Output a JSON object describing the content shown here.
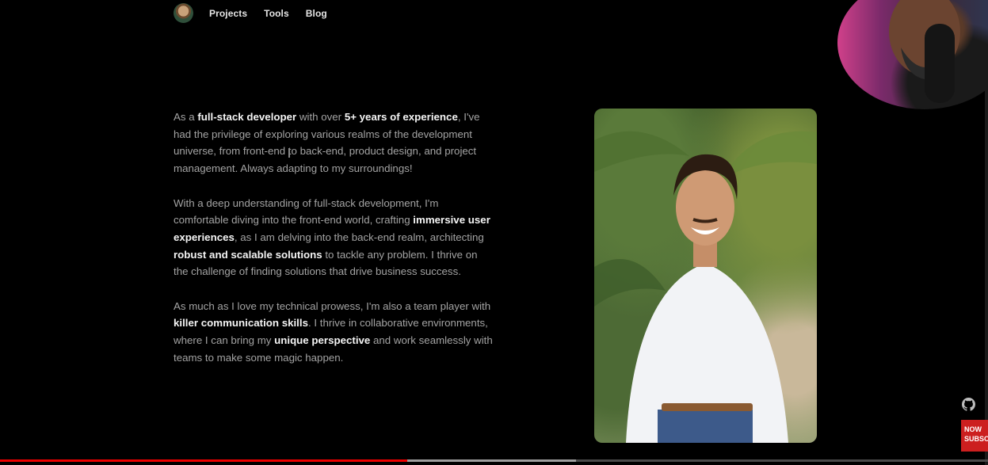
{
  "nav": {
    "links": [
      "Projects",
      "Tools",
      "Blog"
    ]
  },
  "about": {
    "p1": [
      {
        "t": "As a ",
        "b": false
      },
      {
        "t": "full-stack developer",
        "b": true
      },
      {
        "t": " with over ",
        "b": false
      },
      {
        "t": "5+ years of experience",
        "b": true
      },
      {
        "t": ", I've had the privilege of exploring various realms of the development universe, from front-end to back-end, product design, and project management. Always adapting to my surroundings!",
        "b": false
      }
    ],
    "p2": [
      {
        "t": "With a deep understanding of full-stack development, I'm comfortable diving into the front-end world, crafting ",
        "b": false
      },
      {
        "t": "immersive user experiences",
        "b": true
      },
      {
        "t": ", as I am delving into the back-end realm, architecting ",
        "b": false
      },
      {
        "t": "robust and scalable solutions",
        "b": true
      },
      {
        "t": " to tackle any problem. I thrive on the challenge of finding solutions that drive business success.",
        "b": false
      }
    ],
    "p3": [
      {
        "t": "As much as I love my technical prowess, I'm also a team player with ",
        "b": false
      },
      {
        "t": "killer communication skills",
        "b": true
      },
      {
        "t": ". I thrive in collaborative environments, where I can bring my ",
        "b": false
      },
      {
        "t": "unique perspective",
        "b": true
      },
      {
        "t": " and work seamlessly with teams to make some magic happen.",
        "b": false
      }
    ]
  },
  "video": {
    "played_fraction": 0.412,
    "buffered_fraction": 0.583,
    "subscribe_text": "NOW SUBSCRIBE"
  },
  "colors": {
    "background": "#000000",
    "body_text": "#a3a3a3",
    "emphasis_text": "#f5f5f5",
    "progress_played": "#ee0000",
    "subscribe_bg": "#cc1f1f"
  },
  "icons": [
    "avatar",
    "github-icon",
    "subscribe-badge"
  ]
}
